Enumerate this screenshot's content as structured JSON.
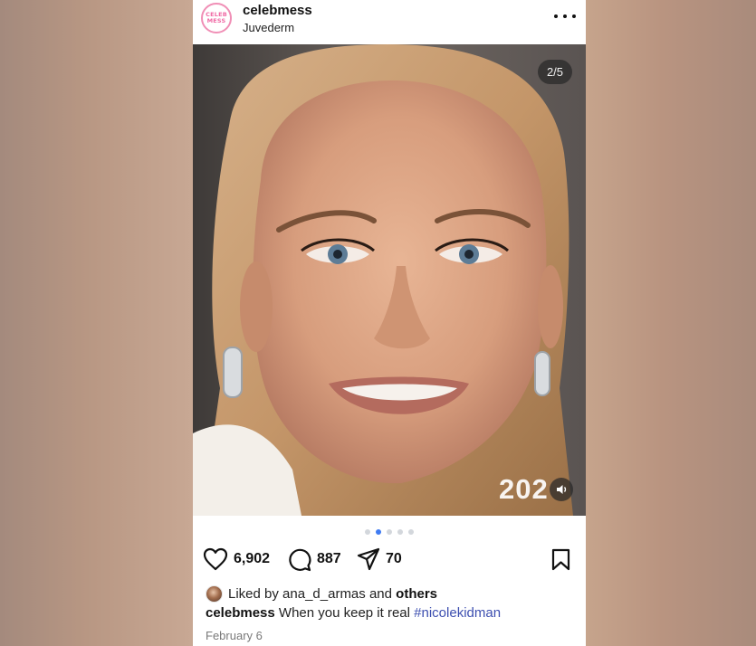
{
  "post": {
    "username": "celebmess",
    "location": "Juvederm",
    "avatar_text": [
      "CELEB",
      "MESS"
    ],
    "more_icon": "more-horizontal-icon",
    "media": {
      "counter": "2/5",
      "overlay_text": "202",
      "sound_icon": "speaker-icon",
      "total_slides": 5,
      "active_slide": 2
    },
    "actions": {
      "likes": "6,902",
      "comments": "887",
      "shares": "70",
      "like_icon": "heart-icon",
      "comment_icon": "comment-bubble-icon",
      "share_icon": "send-icon",
      "save_icon": "bookmark-icon"
    },
    "liked_by": {
      "prefix": "Liked by",
      "user": "ana_d_armas",
      "and": "and",
      "others": "others"
    },
    "caption": {
      "user": "celebmess",
      "text": "When you keep it real",
      "hashtag": "#nicolekidman"
    },
    "date": "February 6"
  },
  "colors": {
    "avatar_ring": "#f08fb6",
    "active_dot": "#3f7bf2",
    "hashtag": "#3d4fb0"
  }
}
